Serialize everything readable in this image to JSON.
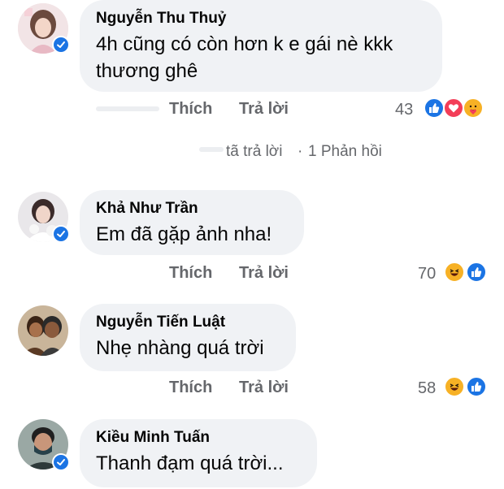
{
  "comments": [
    {
      "author": "Nguyễn Thu Thuỷ",
      "text_line1": "4h cũng có còn hơn k e gái nè kkk",
      "text_line2": "thương ghê",
      "like_label": "Thích",
      "reply_label": "Trả lời",
      "reaction_count": "43",
      "reactions": [
        "like-icon",
        "love-icon",
        "care-icon"
      ]
    },
    {
      "author": "Khả Như Trần",
      "text_line1": "Em đã gặp ảnh nha!",
      "like_label": "Thích",
      "reply_label": "Trả lời",
      "reaction_count": "70",
      "reactions": [
        "haha-icon",
        "like-icon"
      ]
    },
    {
      "author": "Nguyễn Tiến Luật",
      "text_line1": "Nhẹ nhàng quá trời",
      "like_label": "Thích",
      "reply_label": "Trả lời",
      "reaction_count": "58",
      "reactions": [
        "haha-icon",
        "like-icon"
      ]
    },
    {
      "author": "Kiều Minh Tuấn",
      "text_line1": "Thanh đạm quá trời..."
    }
  ],
  "replies_summary": {
    "replied_label": "tã trả lời",
    "separator": "·",
    "count_label": "1 Phản hồi"
  },
  "colors": {
    "bubble": "#f0f2f5",
    "secondary_text": "#65676b",
    "facebook_blue": "#1b74e4",
    "love_red": "#f33e58",
    "haha_yellow": "#f7b125"
  }
}
